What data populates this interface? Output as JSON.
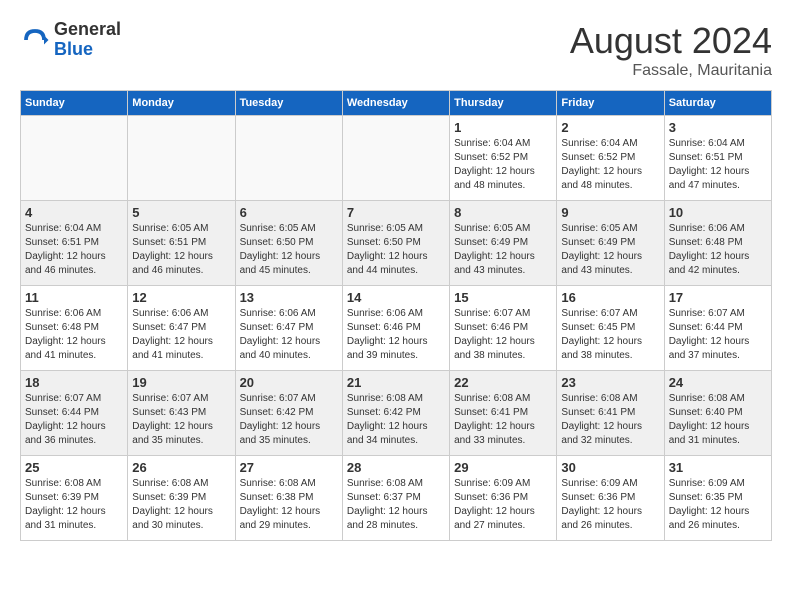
{
  "logo": {
    "general": "General",
    "blue": "Blue"
  },
  "header": {
    "month_year": "August 2024",
    "location": "Fassale, Mauritania"
  },
  "days_of_week": [
    "Sunday",
    "Monday",
    "Tuesday",
    "Wednesday",
    "Thursday",
    "Friday",
    "Saturday"
  ],
  "weeks": [
    {
      "alt": false,
      "days": [
        {
          "num": "",
          "info": ""
        },
        {
          "num": "",
          "info": ""
        },
        {
          "num": "",
          "info": ""
        },
        {
          "num": "",
          "info": ""
        },
        {
          "num": "1",
          "info": "Sunrise: 6:04 AM\nSunset: 6:52 PM\nDaylight: 12 hours\nand 48 minutes."
        },
        {
          "num": "2",
          "info": "Sunrise: 6:04 AM\nSunset: 6:52 PM\nDaylight: 12 hours\nand 48 minutes."
        },
        {
          "num": "3",
          "info": "Sunrise: 6:04 AM\nSunset: 6:51 PM\nDaylight: 12 hours\nand 47 minutes."
        }
      ]
    },
    {
      "alt": true,
      "days": [
        {
          "num": "4",
          "info": "Sunrise: 6:04 AM\nSunset: 6:51 PM\nDaylight: 12 hours\nand 46 minutes."
        },
        {
          "num": "5",
          "info": "Sunrise: 6:05 AM\nSunset: 6:51 PM\nDaylight: 12 hours\nand 46 minutes."
        },
        {
          "num": "6",
          "info": "Sunrise: 6:05 AM\nSunset: 6:50 PM\nDaylight: 12 hours\nand 45 minutes."
        },
        {
          "num": "7",
          "info": "Sunrise: 6:05 AM\nSunset: 6:50 PM\nDaylight: 12 hours\nand 44 minutes."
        },
        {
          "num": "8",
          "info": "Sunrise: 6:05 AM\nSunset: 6:49 PM\nDaylight: 12 hours\nand 43 minutes."
        },
        {
          "num": "9",
          "info": "Sunrise: 6:05 AM\nSunset: 6:49 PM\nDaylight: 12 hours\nand 43 minutes."
        },
        {
          "num": "10",
          "info": "Sunrise: 6:06 AM\nSunset: 6:48 PM\nDaylight: 12 hours\nand 42 minutes."
        }
      ]
    },
    {
      "alt": false,
      "days": [
        {
          "num": "11",
          "info": "Sunrise: 6:06 AM\nSunset: 6:48 PM\nDaylight: 12 hours\nand 41 minutes."
        },
        {
          "num": "12",
          "info": "Sunrise: 6:06 AM\nSunset: 6:47 PM\nDaylight: 12 hours\nand 41 minutes."
        },
        {
          "num": "13",
          "info": "Sunrise: 6:06 AM\nSunset: 6:47 PM\nDaylight: 12 hours\nand 40 minutes."
        },
        {
          "num": "14",
          "info": "Sunrise: 6:06 AM\nSunset: 6:46 PM\nDaylight: 12 hours\nand 39 minutes."
        },
        {
          "num": "15",
          "info": "Sunrise: 6:07 AM\nSunset: 6:46 PM\nDaylight: 12 hours\nand 38 minutes."
        },
        {
          "num": "16",
          "info": "Sunrise: 6:07 AM\nSunset: 6:45 PM\nDaylight: 12 hours\nand 38 minutes."
        },
        {
          "num": "17",
          "info": "Sunrise: 6:07 AM\nSunset: 6:44 PM\nDaylight: 12 hours\nand 37 minutes."
        }
      ]
    },
    {
      "alt": true,
      "days": [
        {
          "num": "18",
          "info": "Sunrise: 6:07 AM\nSunset: 6:44 PM\nDaylight: 12 hours\nand 36 minutes."
        },
        {
          "num": "19",
          "info": "Sunrise: 6:07 AM\nSunset: 6:43 PM\nDaylight: 12 hours\nand 35 minutes."
        },
        {
          "num": "20",
          "info": "Sunrise: 6:07 AM\nSunset: 6:42 PM\nDaylight: 12 hours\nand 35 minutes."
        },
        {
          "num": "21",
          "info": "Sunrise: 6:08 AM\nSunset: 6:42 PM\nDaylight: 12 hours\nand 34 minutes."
        },
        {
          "num": "22",
          "info": "Sunrise: 6:08 AM\nSunset: 6:41 PM\nDaylight: 12 hours\nand 33 minutes."
        },
        {
          "num": "23",
          "info": "Sunrise: 6:08 AM\nSunset: 6:41 PM\nDaylight: 12 hours\nand 32 minutes."
        },
        {
          "num": "24",
          "info": "Sunrise: 6:08 AM\nSunset: 6:40 PM\nDaylight: 12 hours\nand 31 minutes."
        }
      ]
    },
    {
      "alt": false,
      "days": [
        {
          "num": "25",
          "info": "Sunrise: 6:08 AM\nSunset: 6:39 PM\nDaylight: 12 hours\nand 31 minutes."
        },
        {
          "num": "26",
          "info": "Sunrise: 6:08 AM\nSunset: 6:39 PM\nDaylight: 12 hours\nand 30 minutes."
        },
        {
          "num": "27",
          "info": "Sunrise: 6:08 AM\nSunset: 6:38 PM\nDaylight: 12 hours\nand 29 minutes."
        },
        {
          "num": "28",
          "info": "Sunrise: 6:08 AM\nSunset: 6:37 PM\nDaylight: 12 hours\nand 28 minutes."
        },
        {
          "num": "29",
          "info": "Sunrise: 6:09 AM\nSunset: 6:36 PM\nDaylight: 12 hours\nand 27 minutes."
        },
        {
          "num": "30",
          "info": "Sunrise: 6:09 AM\nSunset: 6:36 PM\nDaylight: 12 hours\nand 26 minutes."
        },
        {
          "num": "31",
          "info": "Sunrise: 6:09 AM\nSunset: 6:35 PM\nDaylight: 12 hours\nand 26 minutes."
        }
      ]
    }
  ]
}
